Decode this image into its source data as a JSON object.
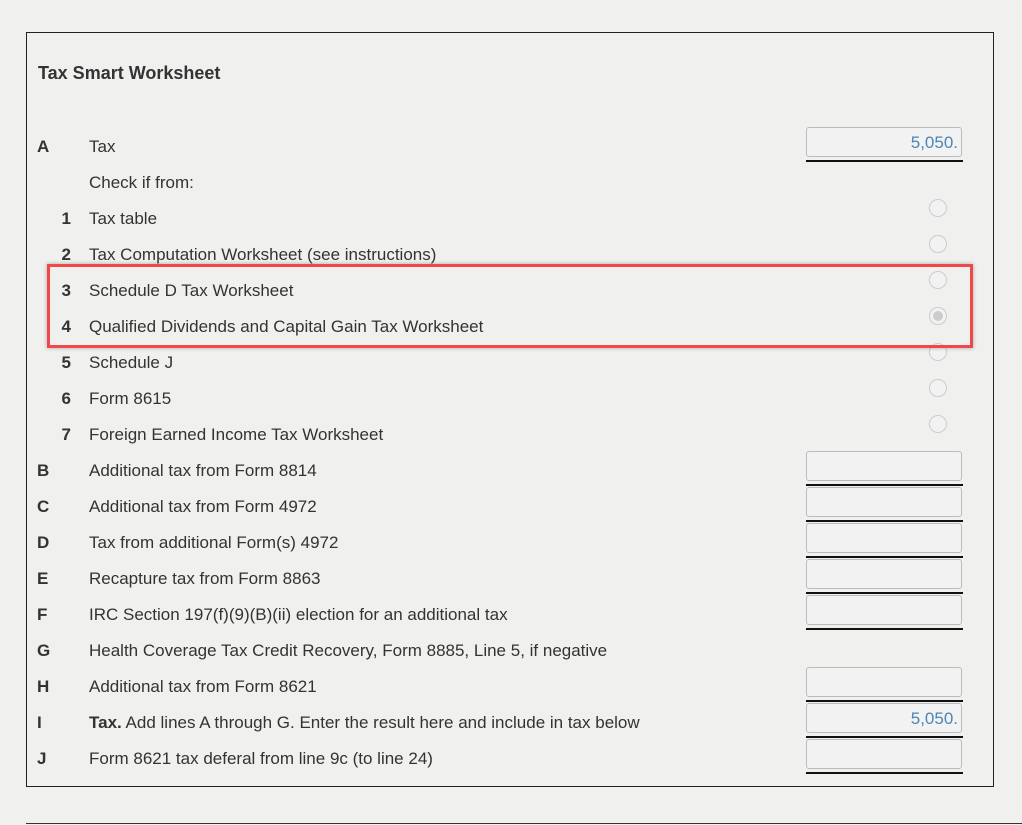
{
  "title": "Tax Smart Worksheet",
  "rows": [
    {
      "letter": "A",
      "label": "Tax",
      "value": "5,050.",
      "input": true
    },
    {
      "label": "Check if from:"
    },
    {
      "num": "1",
      "label": "Tax table",
      "radio": false
    },
    {
      "num": "2",
      "label": "Tax Computation Worksheet (see instructions)",
      "radio": false
    },
    {
      "num": "3",
      "label": "Schedule D Tax Worksheet",
      "radio": false
    },
    {
      "num": "4",
      "label": "Qualified Dividends and Capital Gain Tax Worksheet",
      "radio": true
    },
    {
      "num": "5",
      "label": "Schedule J",
      "radio": false
    },
    {
      "num": "6",
      "label": "Form 8615",
      "radio": false
    },
    {
      "num": "7",
      "label": "Foreign Earned Income Tax Worksheet",
      "radio": false
    },
    {
      "letter": "B",
      "label": "Additional tax from Form 8814",
      "value": "",
      "input": true
    },
    {
      "letter": "C",
      "label": "Additional tax from Form 4972",
      "value": "",
      "input": true
    },
    {
      "letter": "D",
      "label": "Tax from additional Form(s) 4972",
      "value": "",
      "input": true
    },
    {
      "letter": "E",
      "label": "Recapture tax from Form 8863",
      "value": "",
      "input": true
    },
    {
      "letter": "F",
      "label": "IRC Section 197(f)(9)(B)(ii) election for an additional tax",
      "value": "",
      "input": true
    },
    {
      "letter": "G",
      "label": "Health Coverage Tax Credit Recovery, Form 8885, Line 5, if negative"
    },
    {
      "letter": "H",
      "label": "Additional tax from Form 8621",
      "value": "",
      "input": true
    },
    {
      "letter": "I",
      "bold": "Tax.",
      "label": " Add lines A through G. Enter the result here and include in tax below",
      "value": "5,050.",
      "input": true
    },
    {
      "letter": "J",
      "label": "Form 8621 tax deferal from line 9c (to line 24)",
      "value": "",
      "input": true
    }
  ]
}
